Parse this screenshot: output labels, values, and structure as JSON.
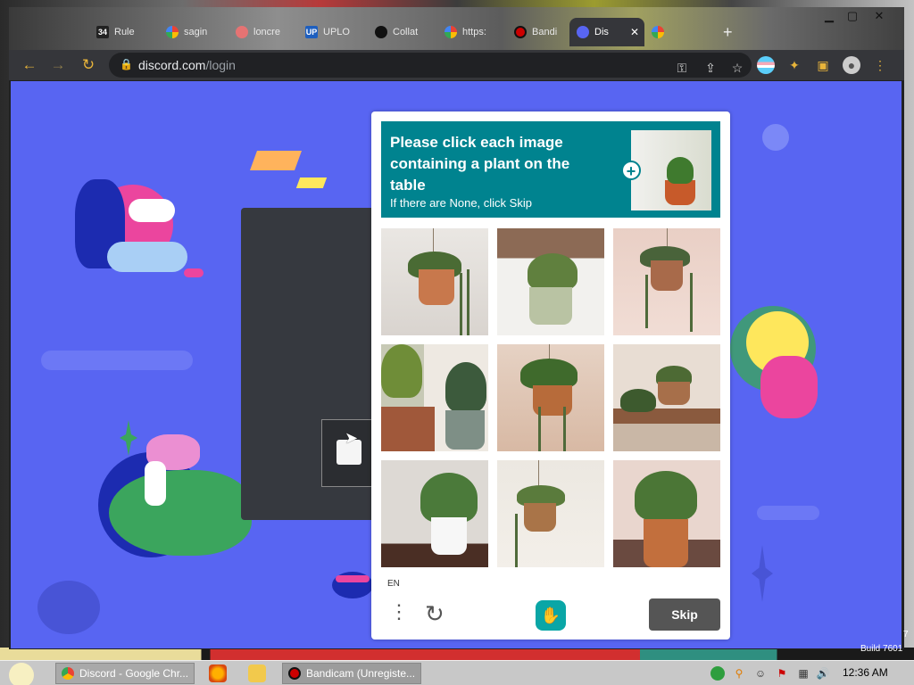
{
  "browser": {
    "tabs": [
      {
        "label": "Rule",
        "favicon": "number-icon"
      },
      {
        "label": "sagin",
        "favicon": "google-icon"
      },
      {
        "label": "loncre",
        "favicon": "app-icon"
      },
      {
        "label": "UPLO",
        "favicon": "upload-icon"
      },
      {
        "label": "Collat",
        "favicon": "github-icon"
      },
      {
        "label": "https:",
        "favicon": "google-icon"
      },
      {
        "label": "Bandi",
        "favicon": "record-icon"
      },
      {
        "label": "Dis",
        "favicon": "discord-icon"
      },
      {
        "label": "",
        "favicon": "google-icon"
      }
    ],
    "active_tab_index": 7,
    "url_domain": "discord.com",
    "url_path": "/login"
  },
  "captcha": {
    "title": "Please click each image containing a plant on the table",
    "subtitle": "If there are None, click Skip",
    "language": "EN",
    "skip_label": "Skip",
    "images": [
      "hanging-pot-plant",
      "table-pot-plant",
      "hanging-pot-plant",
      "aloe-plants-on-table",
      "hanging-pot-plant",
      "hanging-pot-plant",
      "aloe-white-pot-on-table",
      "hanging-pot-plant",
      "aloe-terracotta-on-table"
    ]
  },
  "desktop": {
    "build_label": "Build 7601",
    "build_digit": "7"
  },
  "taskbar": {
    "items": [
      {
        "label": "Discord - Google Chr..."
      },
      {
        "label": "Bandicam (Unregiste..."
      }
    ],
    "clock": "12:36 AM"
  },
  "colors": {
    "discord_blurple": "#5865f2",
    "hcaptcha_teal": "#00838f",
    "skip_button": "#555555"
  }
}
